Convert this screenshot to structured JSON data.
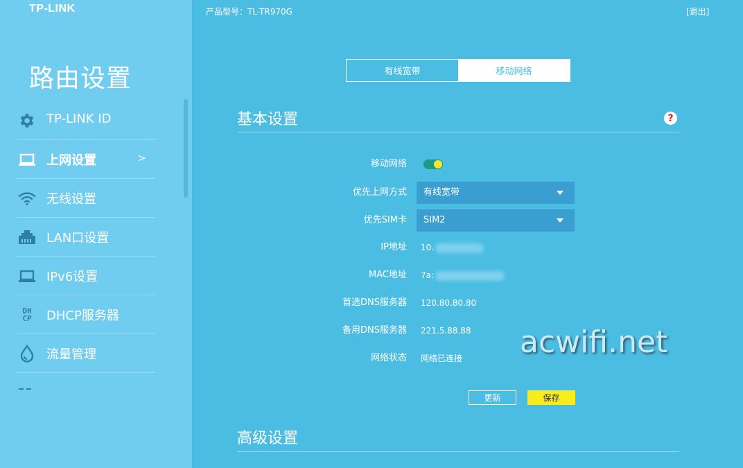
{
  "brand": {
    "logo": "TP-LINK"
  },
  "header": {
    "model": "产品型号：TL-TR970G",
    "logout": "[退出]"
  },
  "sidebar": {
    "title": "路由设置",
    "items": [
      {
        "label": "TP-LINK ID",
        "icon": "gear-icon"
      },
      {
        "label": "上网设置",
        "icon": "laptop-icon",
        "active": true,
        "arrow": ">"
      },
      {
        "label": "无线设置",
        "icon": "wifi-icon"
      },
      {
        "label": "LAN口设置",
        "icon": "lan-port-icon"
      },
      {
        "label": "IPv6设置",
        "icon": "laptop-icon"
      },
      {
        "label": "DHCP服务器",
        "icon": "dhcp-icon",
        "icon_text": [
          "DH",
          "CP"
        ]
      },
      {
        "label": "流量管理",
        "icon": "water-drop-icon"
      }
    ]
  },
  "tabs": [
    {
      "label": "有线宽带",
      "active": false
    },
    {
      "label": "移动网络",
      "active": true
    }
  ],
  "basic": {
    "title": "基本设置",
    "help": "?",
    "mobile_network_label": "移动网络",
    "mobile_network_enabled": true,
    "preferred_method_label": "优先上网方式",
    "preferred_method_value": "有线宽带",
    "preferred_sim_label": "优先SIM卡",
    "preferred_sim_value": "SIM2",
    "ip_label": "IP地址",
    "ip_value": "10.",
    "mac_label": "MAC地址",
    "mac_value": "7a:",
    "dns1_label": "首选DNS服务器",
    "dns1_value": "120.80.80.80",
    "dns2_label": "备用DNS服务器",
    "dns2_value": "221.5.88.88",
    "status_label": "网络状态",
    "status_value": "网络已连接",
    "refresh_label": "更新",
    "save_label": "保存"
  },
  "advanced": {
    "title": "高级设置"
  },
  "watermark": "acwifi.net",
  "colors": {
    "accent": "#4bbde3",
    "sidebar": "#71cdef",
    "save": "#f8ec1d",
    "toggle": "#1b9a8a",
    "help": "#d9261c"
  }
}
